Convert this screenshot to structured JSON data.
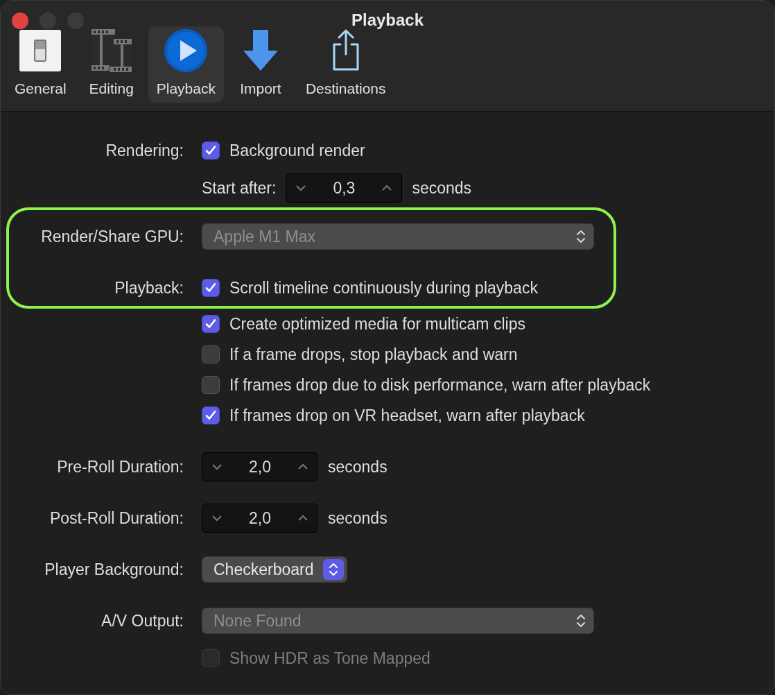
{
  "window": {
    "title": "Playback"
  },
  "toolbar": [
    {
      "kind": "switch",
      "label": "General",
      "selected": false
    },
    {
      "kind": "film",
      "label": "Editing",
      "selected": false
    },
    {
      "kind": "play",
      "label": "Playback",
      "selected": true
    },
    {
      "kind": "download",
      "label": "Import",
      "selected": false
    },
    {
      "kind": "share",
      "label": "Destinations",
      "selected": false
    }
  ],
  "rows": [
    {
      "kind": "checkbox",
      "label": "Rendering:",
      "text": "Background render",
      "checked": true,
      "disabled": false,
      "highlighted": false
    },
    {
      "kind": "stepper",
      "inline_label": "Start after:",
      "value": "0,3",
      "unit": "seconds",
      "highlighted": false
    },
    {
      "kind": "popup",
      "label": "Render/Share GPU:",
      "value": "Apple M1 Max",
      "disabled": true,
      "highlighted": true
    },
    {
      "kind": "checkbox",
      "label": "Playback:",
      "text": "Scroll timeline continuously during playback",
      "checked": true,
      "disabled": false,
      "highlighted": true
    },
    {
      "kind": "checkbox",
      "text": "Create optimized media for multicam clips",
      "checked": true,
      "disabled": false,
      "highlighted": false
    },
    {
      "kind": "checkbox",
      "text": "If a frame drops, stop playback and warn",
      "checked": false,
      "disabled": false,
      "highlighted": false
    },
    {
      "kind": "checkbox",
      "text": "If frames drop due to disk performance, warn after playback",
      "checked": false,
      "disabled": false,
      "highlighted": false
    },
    {
      "kind": "checkbox",
      "text": "If frames drop on VR headset, warn after playback",
      "checked": true,
      "disabled": false,
      "highlighted": false
    },
    {
      "kind": "stepper",
      "label": "Pre-Roll Duration:",
      "value": "2,0",
      "unit": "seconds",
      "highlighted": false
    },
    {
      "kind": "stepper",
      "label": "Post-Roll Duration:",
      "value": "2,0",
      "unit": "seconds",
      "highlighted": false
    },
    {
      "kind": "popup",
      "label": "Player Background:",
      "value": "Checkerboard",
      "disabled": false,
      "highlighted": false
    },
    {
      "kind": "popup",
      "label": "A/V Output:",
      "value": "None Found",
      "disabled": true,
      "highlighted": false
    },
    {
      "kind": "checkbox",
      "text": "Show HDR as Tone Mapped",
      "checked": false,
      "disabled": true,
      "highlighted": false
    }
  ]
}
